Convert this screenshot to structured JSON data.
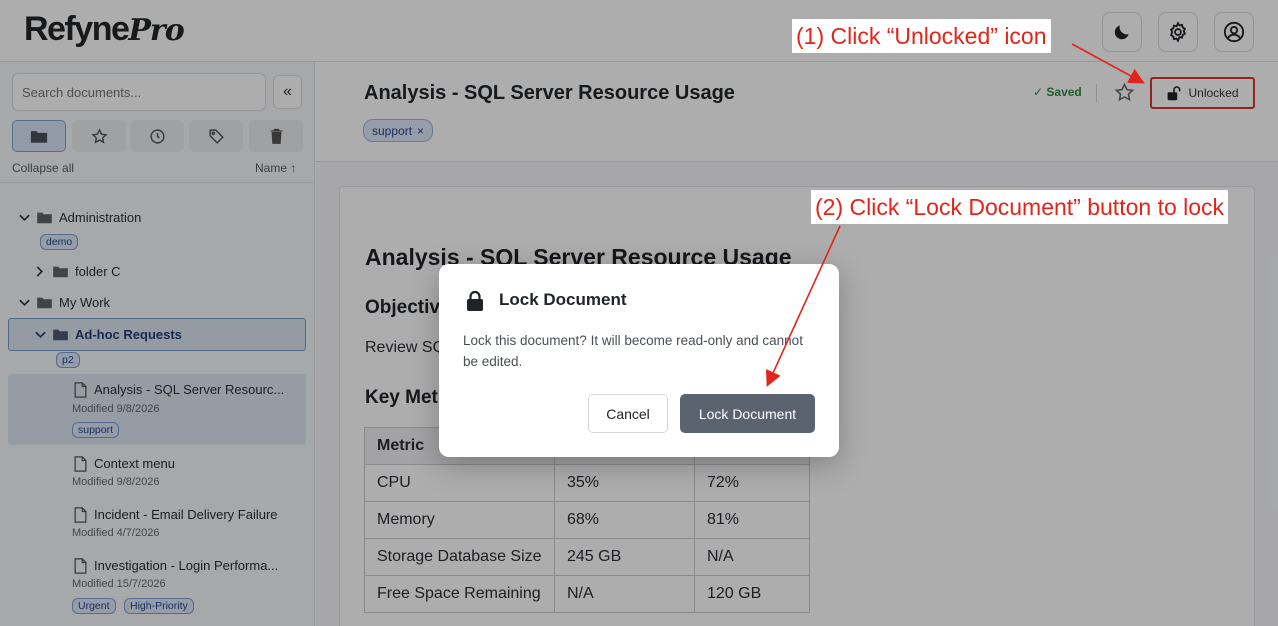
{
  "app": {
    "logo_main": "Refyne",
    "logo_accent": "Pro"
  },
  "header": {
    "buttons": [
      "moon-icon",
      "gear-icon",
      "user-icon"
    ]
  },
  "sidebar": {
    "search_placeholder": "Search documents...",
    "collapse_label": "«",
    "collapse_all": "Collapse all",
    "sort_label": "Name ↑",
    "toolbar": [
      "folder",
      "star",
      "clock",
      "tag",
      "trash"
    ],
    "tree": {
      "administration": {
        "label": "Administration",
        "tag": "demo"
      },
      "folder_c": {
        "label": "folder C"
      },
      "my_work": {
        "label": "My Work"
      },
      "adhoc": {
        "label": "Ad-hoc Requests",
        "tag": "p2"
      },
      "docs": [
        {
          "title": "Analysis - SQL Server Resourc...",
          "meta": "Modified 9/8/2026",
          "tags": [
            "support"
          ]
        },
        {
          "title": "Context menu",
          "meta": "Modified 9/8/2026",
          "tags": []
        },
        {
          "title": "Incident - Email Delivery Failure",
          "meta": "Modified 4/7/2026",
          "tags": []
        },
        {
          "title": "Investigation - Login Performa...",
          "meta": "Modified 15/7/2026",
          "tags": [
            "Urgent",
            "High-Priority"
          ]
        }
      ]
    }
  },
  "document": {
    "title": "Analysis - SQL Server Resource Usage",
    "tag": "support",
    "tag_remove": "×",
    "saved": "✓ Saved",
    "lock_label": "Unlocked",
    "heading": "Analysis - SQL Server Resource Usage",
    "objective_heading": "Objective",
    "objective_text": "Review SQ",
    "metrics_heading": "Key Met",
    "table": {
      "header": [
        "Metric",
        "",
        ""
      ],
      "rows": [
        [
          "CPU",
          "35%",
          "72%"
        ],
        [
          "Memory",
          "68%",
          "81%"
        ],
        [
          "Storage Database Size",
          "245 GB",
          "N/A"
        ],
        [
          "Free Space Remaining",
          "N/A",
          "120 GB"
        ]
      ]
    }
  },
  "modal": {
    "title": "Lock Document",
    "message": "Lock this document? It will become read-only and cannot be edited.",
    "cancel": "Cancel",
    "confirm": "Lock Document"
  },
  "annotations": {
    "step1": "(1) Click “Unlocked” icon",
    "step2": "(2) Click “Lock Document” button to lock",
    "color": "#e3241b"
  }
}
